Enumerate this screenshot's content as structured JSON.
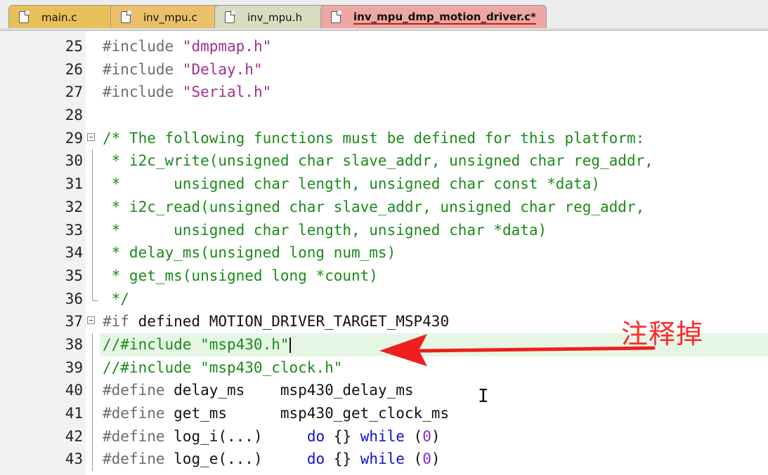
{
  "tabs": [
    {
      "label": "main.c",
      "active": false
    },
    {
      "label": "inv_mpu.c",
      "active": false
    },
    {
      "label": "inv_mpu.h",
      "active": false
    },
    {
      "label": "inv_mpu_dmp_motion_driver.c*",
      "active": true
    }
  ],
  "lines": [
    {
      "num": "25",
      "tokens": [
        [
          "pp",
          "#include "
        ],
        [
          "str",
          "\"dmpmap.h\""
        ]
      ]
    },
    {
      "num": "26",
      "tokens": [
        [
          "pp",
          "#include "
        ],
        [
          "str",
          "\"Delay.h\""
        ]
      ]
    },
    {
      "num": "27",
      "tokens": [
        [
          "pp",
          "#include "
        ],
        [
          "str",
          "\"Serial.h\""
        ]
      ]
    },
    {
      "num": "28",
      "tokens": []
    },
    {
      "num": "29",
      "fold": "start",
      "tokens": [
        [
          "cm",
          "/* The following functions must be defined for this platform:"
        ]
      ]
    },
    {
      "num": "30",
      "fold": "bar",
      "tokens": [
        [
          "cm",
          " * i2c_write(unsigned char slave_addr, unsigned char reg_addr,"
        ]
      ]
    },
    {
      "num": "31",
      "fold": "bar",
      "tokens": [
        [
          "cm",
          " *      unsigned char length, unsigned char const *data)"
        ]
      ]
    },
    {
      "num": "32",
      "fold": "bar",
      "tokens": [
        [
          "cm",
          " * i2c_read(unsigned char slave_addr, unsigned char reg_addr,"
        ]
      ]
    },
    {
      "num": "33",
      "fold": "bar",
      "tokens": [
        [
          "cm",
          " *      unsigned char length, unsigned char *data)"
        ]
      ]
    },
    {
      "num": "34",
      "fold": "bar",
      "tokens": [
        [
          "cm",
          " * delay_ms(unsigned long num_ms)"
        ]
      ]
    },
    {
      "num": "35",
      "fold": "bar",
      "tokens": [
        [
          "cm",
          " * get_ms(unsigned long *count)"
        ]
      ]
    },
    {
      "num": "36",
      "fold": "end",
      "tokens": [
        [
          "cm",
          " */"
        ]
      ]
    },
    {
      "num": "37",
      "fold": "start",
      "tokens": [
        [
          "pp",
          "#if "
        ],
        [
          "id",
          "defined MOTION_DRIVER_TARGET_MSP430"
        ]
      ]
    },
    {
      "num": "38",
      "fold": "bar",
      "highlight": true,
      "caret": true,
      "tokens": [
        [
          "cm",
          "//#include \"msp430.h\""
        ]
      ]
    },
    {
      "num": "39",
      "fold": "bar",
      "tokens": [
        [
          "cm",
          "//#include \"msp430_clock.h\""
        ]
      ]
    },
    {
      "num": "40",
      "fold": "bar",
      "tokens": [
        [
          "pp",
          "#define "
        ],
        [
          "id",
          "delay_ms    msp430_delay_ms"
        ]
      ]
    },
    {
      "num": "41",
      "fold": "bar",
      "tokens": [
        [
          "pp",
          "#define "
        ],
        [
          "id",
          "get_ms      msp430_get_clock_ms"
        ]
      ]
    },
    {
      "num": "42",
      "fold": "bar",
      "tokens": [
        [
          "pp",
          "#define "
        ],
        [
          "id",
          "log_i(...)     "
        ],
        [
          "kw",
          "do"
        ],
        [
          "id",
          " {} "
        ],
        [
          "kw",
          "while"
        ],
        [
          "id",
          " ("
        ],
        [
          "num",
          "0"
        ],
        [
          "id",
          ")"
        ]
      ]
    },
    {
      "num": "43",
      "fold": "bar",
      "tokens": [
        [
          "pp",
          "#define "
        ],
        [
          "id",
          "log_e(...)     "
        ],
        [
          "kw",
          "do"
        ],
        [
          "id",
          " {} "
        ],
        [
          "kw",
          "while"
        ],
        [
          "id",
          " ("
        ],
        [
          "num",
          "0"
        ],
        [
          "id",
          ")"
        ]
      ]
    }
  ],
  "annotation": {
    "text": "注释掉",
    "color": "#ff2a2a"
  },
  "colors": {
    "comment": "#1a8a1a",
    "string": "#a0308f",
    "preprocessor": "#6c6c6c",
    "keyword": "#1010d0",
    "number": "#8a2bd2",
    "highlight": "#e5f6e5"
  }
}
